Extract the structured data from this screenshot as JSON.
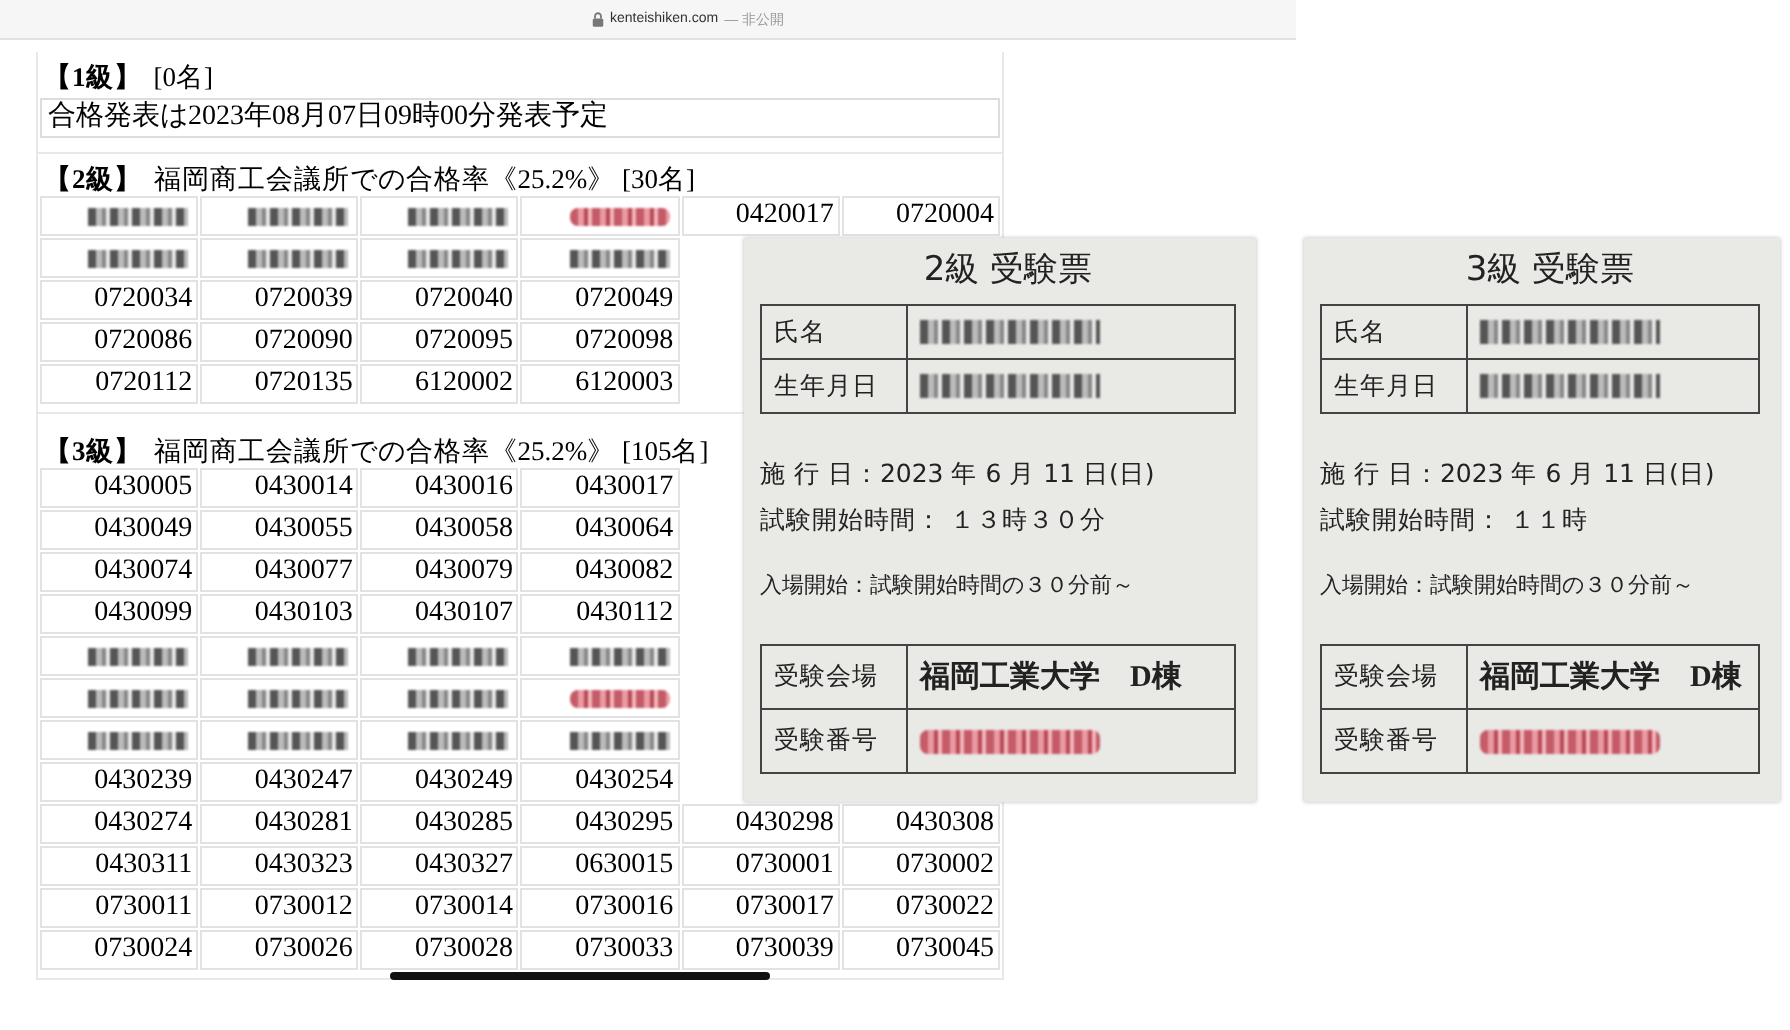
{
  "browser": {
    "url": "kenteishiken.com",
    "note": "— 非公開"
  },
  "sections": [
    {
      "grade": "【1級】",
      "summary": "[0名]",
      "notice": "合格発表は2023年08月07日09時00分発表予定"
    },
    {
      "grade": "【2級】",
      "summary": "福岡商工会議所での合格率《25.2%》 [30名]",
      "rows": [
        [
          {
            "kind": "redacted",
            "marked": false
          },
          {
            "kind": "redacted",
            "marked": false
          },
          {
            "kind": "redacted",
            "marked": false
          },
          {
            "kind": "redacted",
            "marked": true
          },
          {
            "kind": "number",
            "text": "0420017"
          },
          {
            "kind": "number",
            "text": "0720004"
          }
        ],
        [
          {
            "kind": "redacted",
            "marked": false
          },
          {
            "kind": "redacted",
            "marked": false
          },
          {
            "kind": "redacted",
            "marked": false
          },
          {
            "kind": "redacted",
            "marked": false
          }
        ],
        [
          {
            "kind": "number",
            "text": "0720034"
          },
          {
            "kind": "number",
            "text": "0720039"
          },
          {
            "kind": "number",
            "text": "0720040"
          },
          {
            "kind": "number",
            "text": "0720049"
          }
        ],
        [
          {
            "kind": "number",
            "text": "0720086"
          },
          {
            "kind": "number",
            "text": "0720090"
          },
          {
            "kind": "number",
            "text": "0720095"
          },
          {
            "kind": "number",
            "text": "0720098"
          }
        ],
        [
          {
            "kind": "number",
            "text": "0720112"
          },
          {
            "kind": "number",
            "text": "0720135"
          },
          {
            "kind": "number",
            "text": "6120002"
          },
          {
            "kind": "number",
            "text": "6120003"
          }
        ]
      ]
    },
    {
      "grade": "【3級】",
      "summary": "福岡商工会議所での合格率《25.2%》 [105名]",
      "rows": [
        [
          {
            "kind": "number",
            "text": "0430005"
          },
          {
            "kind": "number",
            "text": "0430014"
          },
          {
            "kind": "number",
            "text": "0430016"
          },
          {
            "kind": "number",
            "text": "0430017"
          }
        ],
        [
          {
            "kind": "number",
            "text": "0430049"
          },
          {
            "kind": "number",
            "text": "0430055"
          },
          {
            "kind": "number",
            "text": "0430058"
          },
          {
            "kind": "number",
            "text": "0430064"
          }
        ],
        [
          {
            "kind": "number",
            "text": "0430074"
          },
          {
            "kind": "number",
            "text": "0430077"
          },
          {
            "kind": "number",
            "text": "0430079"
          },
          {
            "kind": "number",
            "text": "0430082"
          }
        ],
        [
          {
            "kind": "number",
            "text": "0430099"
          },
          {
            "kind": "number",
            "text": "0430103"
          },
          {
            "kind": "number",
            "text": "0430107"
          },
          {
            "kind": "number",
            "text": "0430112"
          }
        ],
        [
          {
            "kind": "redacted",
            "marked": false
          },
          {
            "kind": "redacted",
            "marked": false
          },
          {
            "kind": "redacted",
            "marked": false
          },
          {
            "kind": "redacted",
            "marked": false
          }
        ],
        [
          {
            "kind": "redacted",
            "marked": false
          },
          {
            "kind": "redacted",
            "marked": false
          },
          {
            "kind": "redacted",
            "marked": false
          },
          {
            "kind": "redacted",
            "marked": true
          }
        ],
        [
          {
            "kind": "redacted",
            "marked": false
          },
          {
            "kind": "redacted",
            "marked": false
          },
          {
            "kind": "redacted",
            "marked": false
          },
          {
            "kind": "redacted",
            "marked": false
          }
        ],
        [
          {
            "kind": "number",
            "text": "0430239"
          },
          {
            "kind": "number",
            "text": "0430247"
          },
          {
            "kind": "number",
            "text": "0430249"
          },
          {
            "kind": "number",
            "text": "0430254"
          }
        ],
        [
          {
            "kind": "number",
            "text": "0430274"
          },
          {
            "kind": "number",
            "text": "0430281"
          },
          {
            "kind": "number",
            "text": "0430285"
          },
          {
            "kind": "number",
            "text": "0430295"
          },
          {
            "kind": "number",
            "text": "0430298"
          },
          {
            "kind": "number",
            "text": "0430308"
          }
        ],
        [
          {
            "kind": "number",
            "text": "0430311"
          },
          {
            "kind": "number",
            "text": "0430323"
          },
          {
            "kind": "number",
            "text": "0430327"
          },
          {
            "kind": "number",
            "text": "0630015"
          },
          {
            "kind": "number",
            "text": "0730001"
          },
          {
            "kind": "number",
            "text": "0730002"
          }
        ],
        [
          {
            "kind": "number",
            "text": "0730011"
          },
          {
            "kind": "number",
            "text": "0730012"
          },
          {
            "kind": "number",
            "text": "0730014"
          },
          {
            "kind": "number",
            "text": "0730016"
          },
          {
            "kind": "number",
            "text": "0730017"
          },
          {
            "kind": "number",
            "text": "0730022"
          }
        ],
        [
          {
            "kind": "number",
            "text": "0730024"
          },
          {
            "kind": "number",
            "text": "0730026"
          },
          {
            "kind": "number",
            "text": "0730028"
          },
          {
            "kind": "number",
            "text": "0730033"
          },
          {
            "kind": "number",
            "text": "0730039"
          },
          {
            "kind": "number",
            "text": "0730045"
          }
        ]
      ]
    }
  ],
  "tickets": [
    {
      "title": "2級 受験票",
      "fields": [
        {
          "label": "氏名",
          "kind": "redacted",
          "marked": false
        },
        {
          "label": "生年月日",
          "kind": "redacted",
          "marked": false
        }
      ],
      "date": "施 行 日：2023 年 6 月 11 日(日)",
      "start": "試験開始時間： １３時３０分",
      "entry": "入場開始：試験開始時間の３０分前～",
      "venue": [
        {
          "label": "受験会場",
          "kind": "text",
          "text": "福岡工業大学　D棟"
        },
        {
          "label": "受験番号",
          "kind": "redacted",
          "marked": true
        }
      ]
    },
    {
      "title": "3級 受験票",
      "fields": [
        {
          "label": "氏名",
          "kind": "redacted",
          "marked": false
        },
        {
          "label": "生年月日",
          "kind": "redacted",
          "marked": false
        }
      ],
      "date": "施 行 日：2023 年 6 月 11 日(日)",
      "start": "試験開始時間： １１時",
      "entry": "入場開始：試験開始時間の３０分前～",
      "venue": [
        {
          "label": "受験会場",
          "kind": "text",
          "text": "福岡工業大学　D棟"
        },
        {
          "label": "受験番号",
          "kind": "redacted",
          "marked": true
        }
      ]
    }
  ]
}
